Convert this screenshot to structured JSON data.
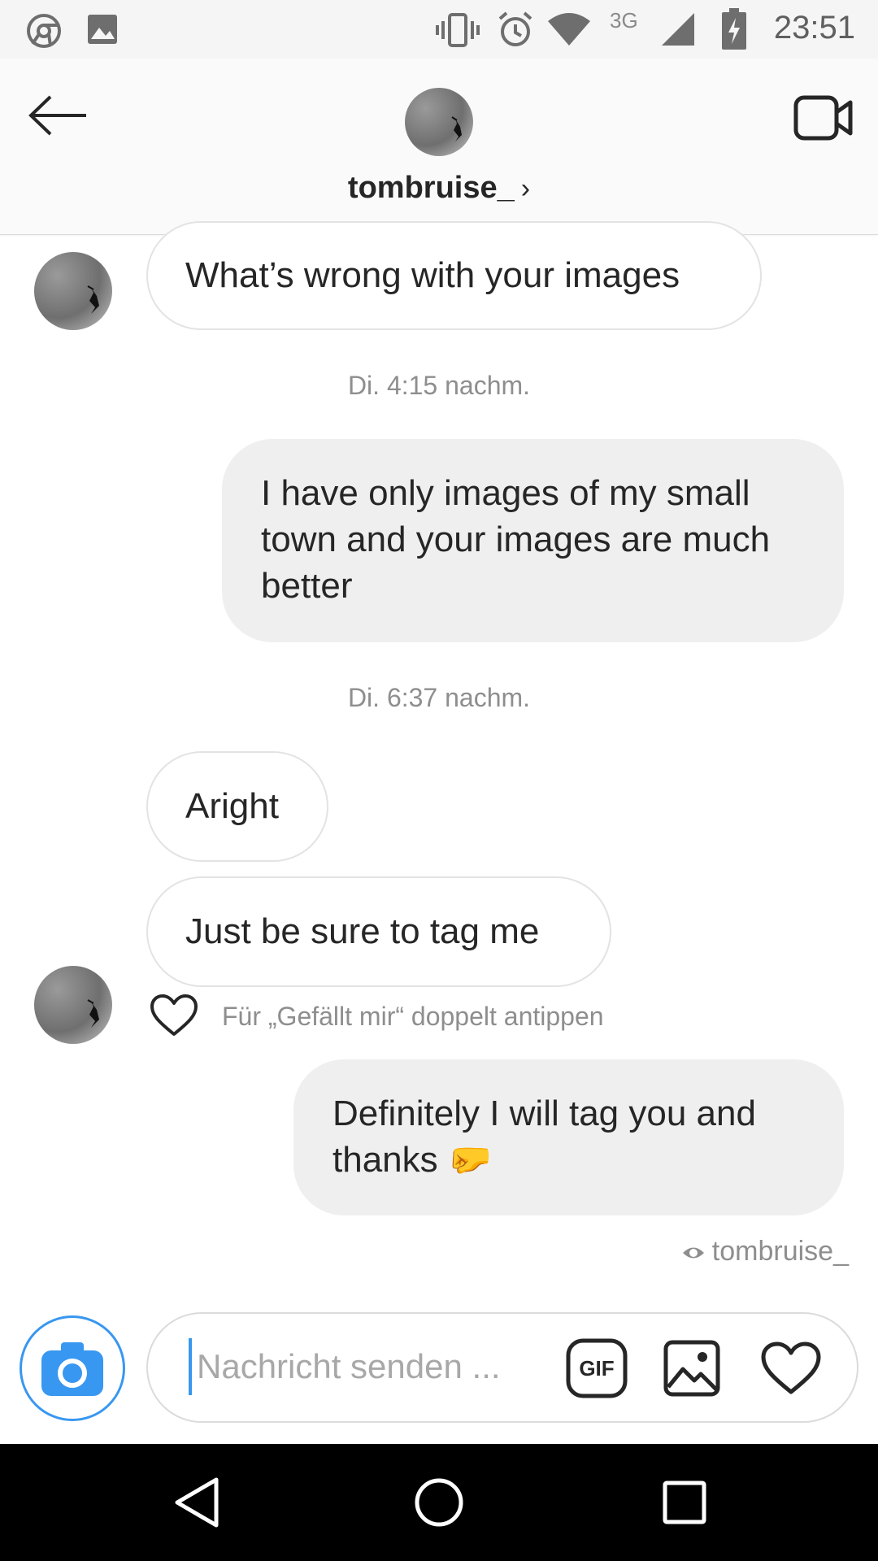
{
  "status_bar": {
    "time": "23:51",
    "network": "3G",
    "icons": [
      "chrome-icon",
      "gallery-icon",
      "vibrate-icon",
      "alarm-icon",
      "wifi-icon",
      "signal-icon",
      "battery-charging-icon"
    ]
  },
  "header": {
    "username": "tombruise_",
    "chevron": "›",
    "icons": [
      "back-arrow-icon",
      "video-call-icon"
    ]
  },
  "messages": [
    {
      "type": "incoming",
      "text": "What’s wrong with your images"
    },
    {
      "type": "timestamp",
      "text": "Di. 4:15 nachm."
    },
    {
      "type": "outgoing",
      "text": "I have only images of my small town and your images are much better"
    },
    {
      "type": "timestamp",
      "text": "Di. 6:37 nachm."
    },
    {
      "type": "incoming",
      "text": "Aright"
    },
    {
      "type": "incoming",
      "text": "Just be sure to tag me"
    },
    {
      "type": "outgoing",
      "text": "Definitely I will tag you and thanks",
      "emoji": "🤛"
    }
  ],
  "like_hint": "Für „Gefällt mir“ doppelt antippen",
  "seen_by": "tombruise_",
  "composer": {
    "placeholder": "Nachricht senden ...",
    "gif_label": "GIF",
    "icons": [
      "camera-icon",
      "gif-icon",
      "image-icon",
      "heart-icon"
    ]
  },
  "nav_bar": {
    "icons": [
      "back-nav-icon",
      "home-nav-icon",
      "recents-nav-icon"
    ]
  },
  "colors": {
    "accent_blue": "#3897f0",
    "bubble_outgoing": "#efefef",
    "bubble_border": "#e3e3e3",
    "muted_text": "#8e8e8e"
  }
}
